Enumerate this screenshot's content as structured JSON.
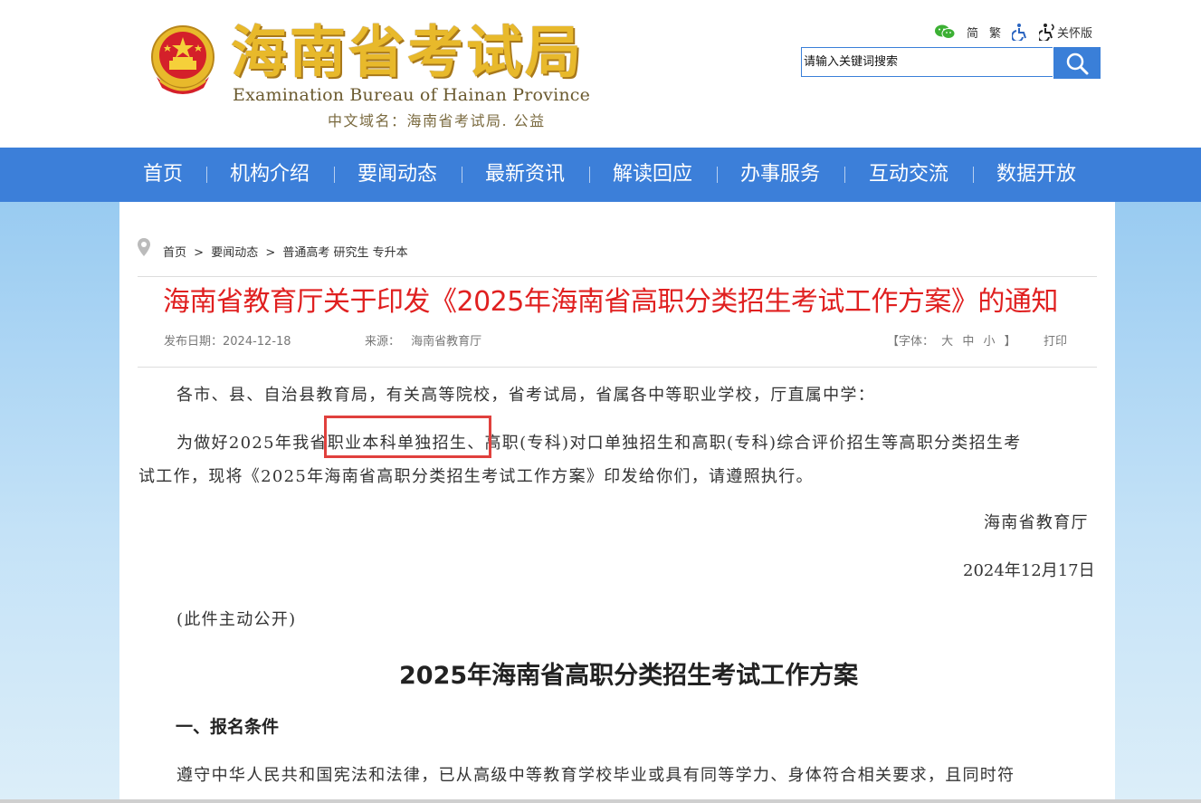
{
  "header": {
    "logo_cn": "海南省考试局",
    "logo_en": "Examination Bureau of Hainan Province",
    "domain_text": "中文域名：海南省考试局. 公益",
    "tools": {
      "simplified": "简",
      "traditional": "繁",
      "care_mode": "关怀版"
    },
    "search": {
      "placeholder": "请输入关键词搜索"
    }
  },
  "nav": {
    "items": [
      "首页",
      "机构介绍",
      "要闻动态",
      "最新资讯",
      "解读回应",
      "办事服务",
      "互动交流",
      "数据开放"
    ]
  },
  "breadcrumb": [
    "首页",
    ">",
    "要闻动态",
    ">",
    "普通高考 研究生 专升本"
  ],
  "article": {
    "title": "海南省教育厅关于印发《2025年海南省高职分类招生考试工作方案》的通知",
    "publish_date_label": "发布日期：",
    "publish_date": "2024-12-18",
    "source_label": "来源：",
    "source": "海南省教育厅",
    "font_label": "【字体：",
    "font_large": "大",
    "font_medium": "中",
    "font_small": "小",
    "font_close": "】",
    "print": "打印",
    "salutation": "各市、县、自治县教育局，有关高等院校，省考试局，省属各中等职业学校，厅直属中学：",
    "para1_line1": "为做好2025年我省职业本科单独招生、高职(专科)对口单独招生和高职(专科)综合评价招生等高职分类招生考",
    "para1_line2": "试工作，现将《2025年海南省高职分类招生考试工作方案》印发给你们，请遵照执行。",
    "signature": "海南省教育厅",
    "date": "2024年12月17日",
    "disclosure": "(此件主动公开)",
    "plan_title": "2025年海南省高职分类招生考试工作方案",
    "section1": "一、报名条件",
    "section1_para": "遵守中华人民共和国宪法和法律，已从高级中等教育学校毕业或具有同等学力、身体符合相关要求，且同时符"
  },
  "colors": {
    "nav_bg": "#3c7fd9",
    "title_red": "#e02020",
    "logo_gold": "#e8b92b",
    "highlight": "#e0403d"
  }
}
